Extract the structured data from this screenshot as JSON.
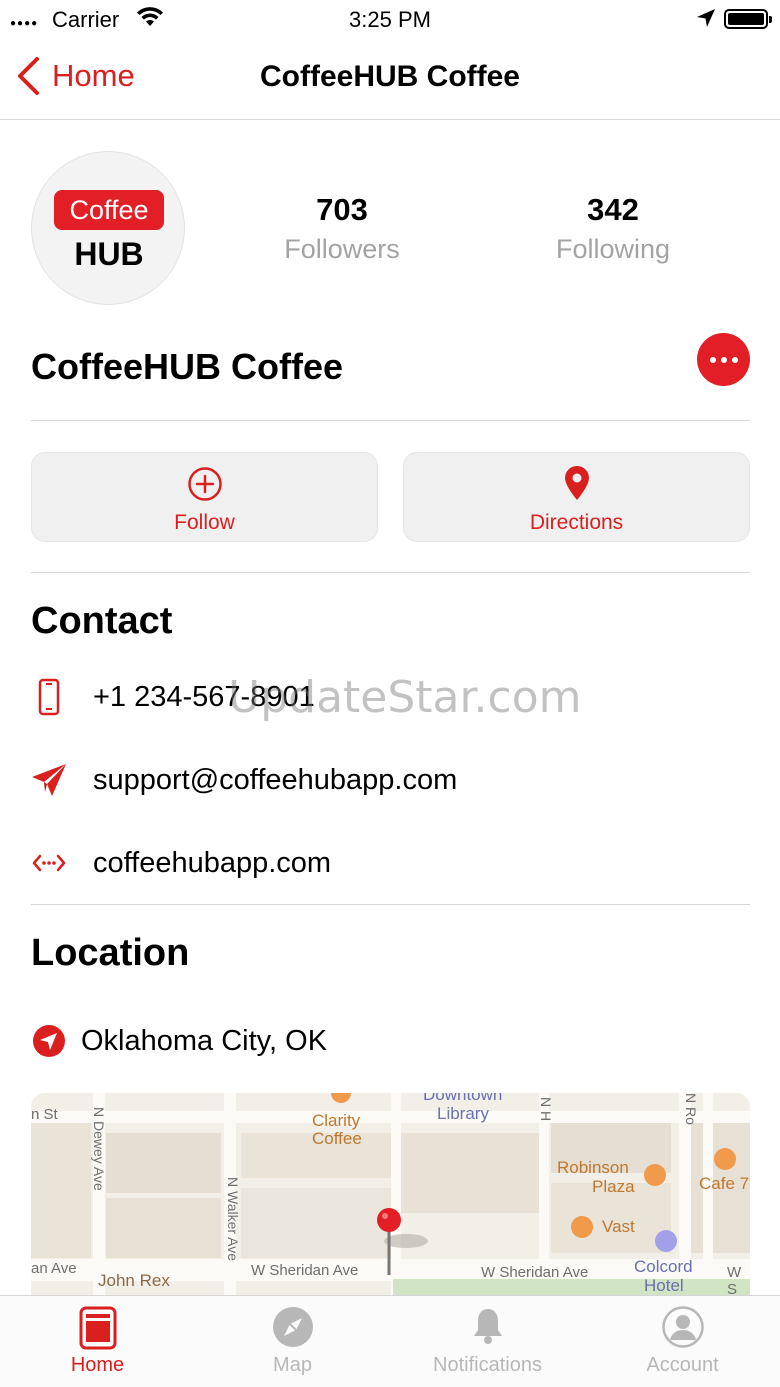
{
  "status_bar": {
    "carrier": "Carrier",
    "time": "3:25 PM"
  },
  "nav": {
    "back_label": "Home",
    "title": "CoffeeHUB Coffee"
  },
  "profile": {
    "logo_top": "Coffee",
    "logo_bottom": "HUB",
    "followers_count": "703",
    "followers_label": "Followers",
    "following_count": "342",
    "following_label": "Following",
    "name": "CoffeeHUB Coffee"
  },
  "actions": {
    "follow_label": "Follow",
    "directions_label": "Directions"
  },
  "contact": {
    "title": "Contact",
    "phone": "+1 234-567-8901",
    "email": "support@coffeehubapp.com",
    "website": "coffeehubapp.com"
  },
  "watermark": "UpdateStar.com",
  "location": {
    "title": "Location",
    "city": "Oklahoma City, OK"
  },
  "map": {
    "labels": {
      "n_st": "n St",
      "dewey": "N Dewey Ave",
      "walker": "N Walker Ave",
      "clarity1": "Clarity",
      "clarity2": "Coffee",
      "downtown1": "Downtown",
      "downtown2": "Library",
      "nh": "N H",
      "nro": "N Ro",
      "robinson1": "Robinson",
      "robinson2": "Plaza",
      "cafe": "Cafe 7",
      "vast": "Vast",
      "colcord1": "Colcord",
      "colcord2": "Hotel",
      "an_ave": "an Ave",
      "john_rex": "John Rex",
      "sheridan1": "W Sheridan Ave",
      "sheridan2": "W Sheridan Ave",
      "ws": "W S"
    }
  },
  "tabs": [
    {
      "label": "Home"
    },
    {
      "label": "Map"
    },
    {
      "label": "Notifications"
    },
    {
      "label": "Account"
    }
  ],
  "colors": {
    "accent": "#d9201f",
    "inactive": "#b7b7b7"
  }
}
